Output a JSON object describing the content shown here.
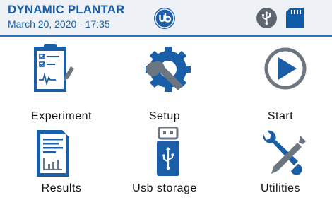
{
  "header": {
    "title": "DYNAMIC PLANTAR",
    "datetime": "March 20, 2020 - 17:35",
    "logo_text": "ub",
    "accent_color": "#1a5ea8"
  },
  "status_icons": [
    "usb-icon",
    "sd-card-icon"
  ],
  "menu": [
    {
      "label": "Experiment",
      "icon": "clipboard-chart-icon"
    },
    {
      "label": "Setup",
      "icon": "gear-wrench-icon"
    },
    {
      "label": "Start",
      "icon": "play-icon"
    },
    {
      "label": "Results",
      "icon": "document-chart-icon"
    },
    {
      "label": "Usb storage",
      "icon": "usb-drive-icon"
    },
    {
      "label": "Utilities",
      "icon": "wrench-screwdriver-icon"
    }
  ]
}
